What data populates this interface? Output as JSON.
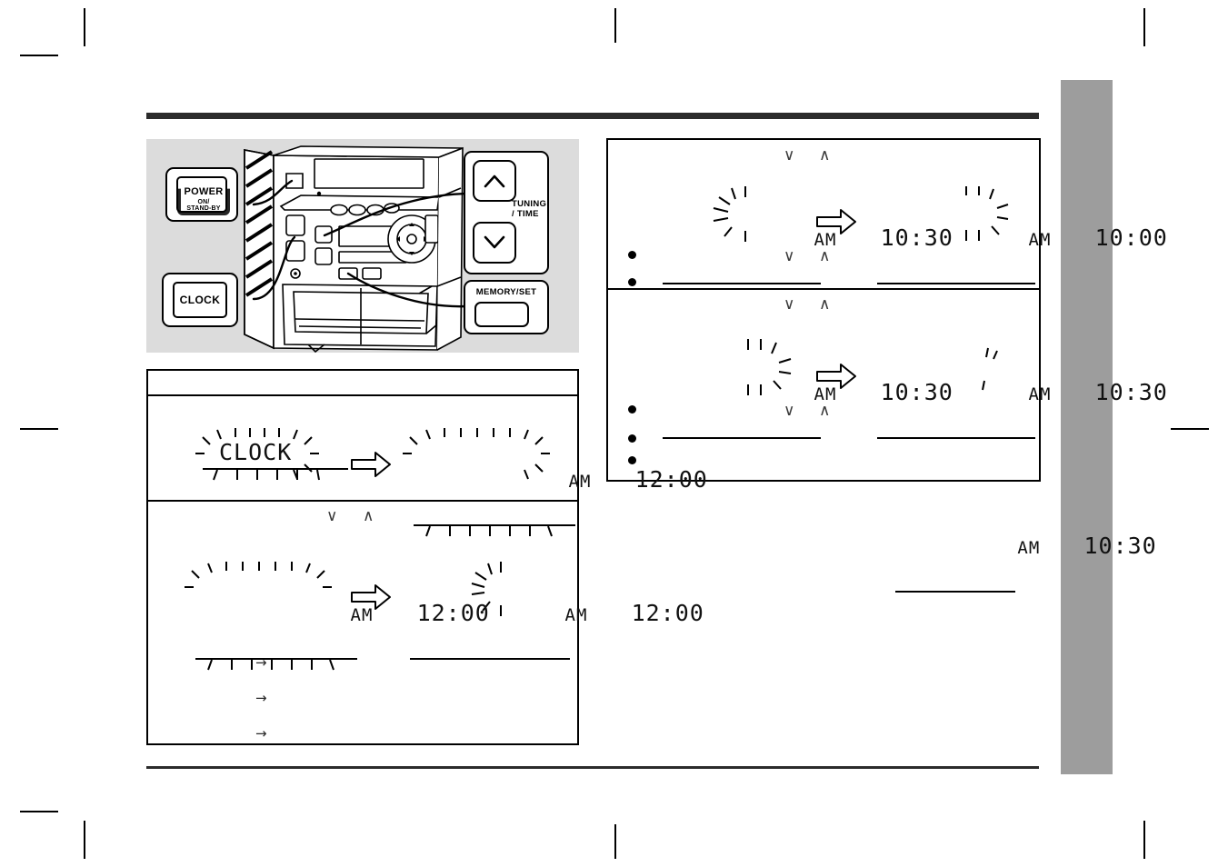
{
  "page": {
    "background_color": "#ffffff",
    "rule_color": "#2b2b2b",
    "side_tab_color": "#9d9d9d",
    "illustration_background": "#dcdcdc"
  },
  "illustration": {
    "name": "stereo-system-front-panel",
    "callouts": [
      {
        "id": "power",
        "label_line1": "POWER",
        "label_line2": "ON/",
        "label_line3": "STAND-BY"
      },
      {
        "id": "clock",
        "label_line1": "CLOCK"
      },
      {
        "id": "tuning_time",
        "label_line1": "TUNING",
        "label_line2": "/ TIME",
        "up_icon": "chevron-up-icon",
        "down_icon": "chevron-down-icon"
      },
      {
        "id": "memory_set",
        "label_line1": "MEMORY/SET"
      }
    ]
  },
  "panels": {
    "left_top": {
      "header_text": "",
      "step": {
        "before": {
          "ampm": "",
          "time": "CLOCK",
          "blink": "all",
          "underline": true,
          "ticks": true
        },
        "arrow_icon": "thick-right-arrow-icon",
        "after": {
          "ampm": "AM",
          "time": "12:00",
          "blink": "all",
          "underline": true,
          "ticks": true
        }
      }
    },
    "left_bottom": {
      "chevrons": {
        "down": "∨",
        "up": "∧"
      },
      "step": {
        "before": {
          "ampm": "AM",
          "time": "12:00",
          "blink": "all",
          "underline": true,
          "ticks": true
        },
        "arrow_icon": "thick-right-arrow-icon",
        "after": {
          "ampm": "AM",
          "time": "12:00",
          "blink": "hours",
          "underline": true,
          "ticks": false
        }
      },
      "sub_arrows": [
        "→",
        "→",
        "→"
      ]
    },
    "right_top": {
      "chevrons_top": {
        "down": "∨",
        "up": "∧"
      },
      "step": {
        "before": {
          "ampm": "AM",
          "time": "10:30",
          "blink": "hours",
          "underline": true
        },
        "arrow_icon": "thick-right-arrow-icon",
        "after": {
          "ampm": "AM",
          "time": "10:00",
          "blink": "minutes",
          "underline": true
        }
      },
      "chevrons_mid": {
        "down": "∨",
        "up": "∧"
      },
      "bullets": 2
    },
    "right_bottom": {
      "chevrons_top": {
        "down": "∨",
        "up": "∧"
      },
      "step": {
        "before": {
          "ampm": "AM",
          "time": "10:30",
          "blink": "minutes",
          "underline": true
        },
        "arrow_icon": "thick-right-arrow-icon",
        "after": {
          "ampm": "AM",
          "time": "10:30",
          "blink": "colon",
          "underline": true
        }
      },
      "chevrons_mid": {
        "down": "∨",
        "up": "∧"
      },
      "bullets": 3
    },
    "standalone_display": {
      "ampm": "AM",
      "time": "10:30",
      "blink": "none",
      "underline": true
    }
  }
}
